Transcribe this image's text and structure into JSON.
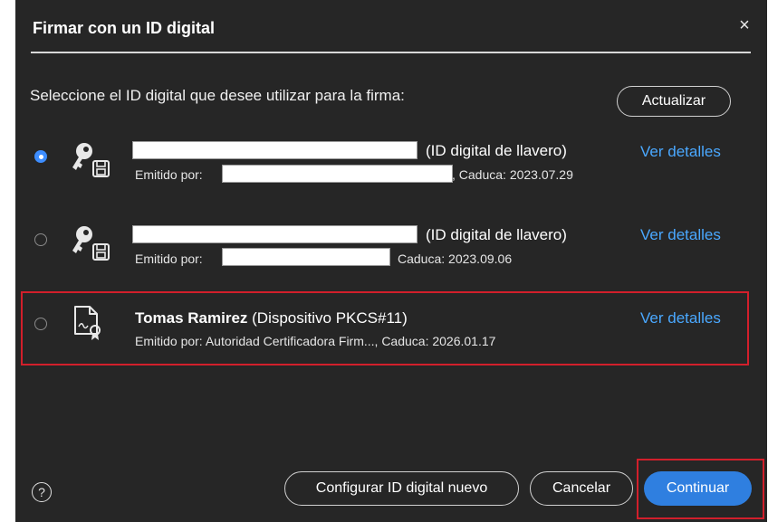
{
  "dialog": {
    "title": "Firmar con un ID digital",
    "close_glyph": "×",
    "prompt": "Seleccione el ID digital que desee utilizar para la firma:",
    "refresh_label": "Actualizar"
  },
  "ids": [
    {
      "selected": true,
      "icon": "key-disk-icon",
      "name": "",
      "type": "(ID digital de llavero)",
      "issued_prefix": "Emitido por:",
      "expiry": ", Caduca: 2023.07.29",
      "details_label": "Ver detalles"
    },
    {
      "selected": false,
      "icon": "key-disk-icon",
      "name": "",
      "type": "(ID digital de llavero)",
      "issued_prefix": "Emitido por:",
      "expiry": "Caduca: 2023.09.06",
      "details_label": "Ver detalles"
    },
    {
      "selected": false,
      "icon": "certificate-document-icon",
      "name": "Tomas Ramirez",
      "type": "(Dispositivo PKCS#11)",
      "issued_line": "Emitido por: Autoridad Certificadora Firm..., Caduca: 2026.01.17",
      "details_label": "Ver detalles"
    }
  ],
  "footer": {
    "help_glyph": "?",
    "configure_label": "Configurar ID digital nuevo",
    "cancel_label": "Cancelar",
    "continue_label": "Continuar"
  },
  "colors": {
    "dialog_bg": "#262626",
    "link": "#4aa8ff",
    "primary_button": "#2f7fe0",
    "annotation_red": "#d21f2b"
  }
}
